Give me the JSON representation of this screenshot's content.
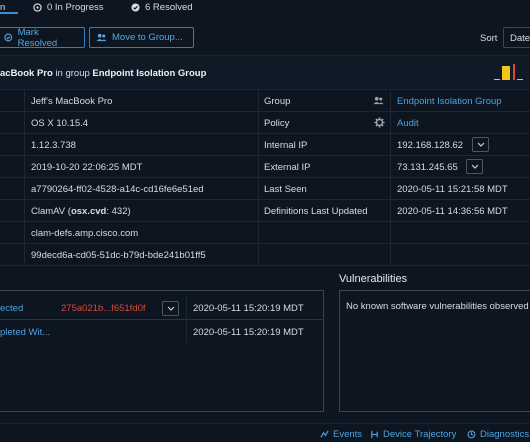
{
  "tabs": [
    {
      "label": "n",
      "active": true
    },
    {
      "label": "0 In Progress",
      "icon": "clock-circle-icon"
    },
    {
      "label": "6 Resolved",
      "icon": "check-circle-icon"
    }
  ],
  "toolbar": {
    "mark_resolved_label": "Mark Resolved",
    "move_to_group_label": "Move to Group...",
    "sort_label": "Sort",
    "sort_value": "Date"
  },
  "header": {
    "device_name": "acBook Pro",
    "in_group_text": " in group ",
    "group_name": "Endpoint Isolation Group"
  },
  "details": {
    "left": [
      {
        "value": "Jeff's MacBook Pro"
      },
      {
        "value": "OS X 10.15.4"
      },
      {
        "value": "1.12.3.738"
      },
      {
        "value": "2019-10-20 22:06:25 MDT"
      },
      {
        "value": "a7790264-ff02-4528-a14c-cd16fe6e51ed"
      },
      {
        "value_bold_prefix": "ClamAV (",
        "value_bold": "osx.cvd",
        "value_suffix": ": 432)"
      },
      {
        "value": "clam-defs.amp.cisco.com"
      },
      {
        "value": "99decd6a-cd05-51dc-b79d-bde241b01ff5"
      }
    ],
    "right": [
      {
        "label": "Group",
        "value": "Endpoint Isolation Group",
        "icon": "users-icon"
      },
      {
        "label": "Policy",
        "value": "Audit",
        "icon": "gear-icon"
      },
      {
        "label": "Internal IP",
        "value": "192.168.128.62"
      },
      {
        "label": "External IP",
        "value": "73.131.245.65"
      },
      {
        "label": "Last Seen",
        "value": "2020-05-11 15:21:58 MDT"
      },
      {
        "label": "Definitions Last Updated",
        "value": "2020-05-11 14:36:56 MDT"
      }
    ]
  },
  "events": [
    {
      "name": "ected",
      "hash": "275a021b...f651fd0f",
      "time": "2020-05-11 15:20:19 MDT"
    },
    {
      "name": "pleted Wit...",
      "time": "2020-05-11 15:20:19 MDT"
    }
  ],
  "vulnerabilities": {
    "title": "Vulnerabilities",
    "message": "No known software vulnerabilities observed"
  },
  "footer": {
    "events_label": "Events",
    "trajectory_label": "Device Trajectory",
    "diagnostics_label": "Diagnostics"
  },
  "colors": {
    "background": "#0c1520",
    "accent_blue": "#4ea3e0",
    "alert_red": "#e0473a",
    "sparkline_yellow": "#f5c518"
  }
}
